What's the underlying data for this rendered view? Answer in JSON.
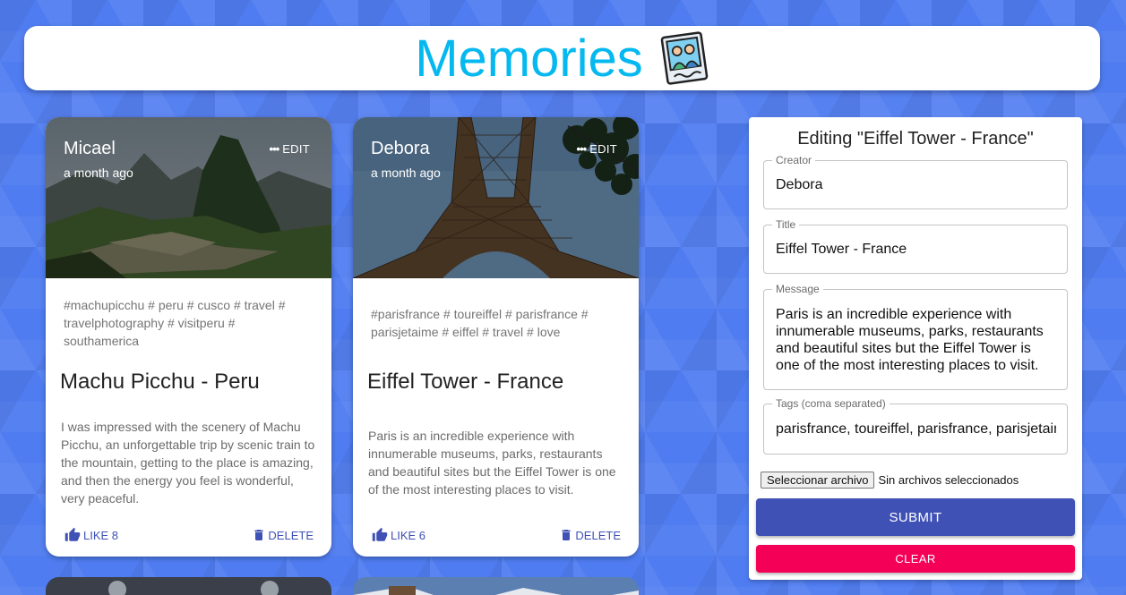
{
  "app": {
    "title": "Memories",
    "logo_icon": "memories-photo-icon",
    "accent": "#05b8ef"
  },
  "posts": [
    {
      "creator": "Micael",
      "time": "a month ago",
      "edit_label": "EDIT",
      "tags": "#machupicchu # peru # cusco # travel # travelphotography # visitperu # southamerica",
      "title": "Machu Picchu - Peru",
      "message": "I was impressed with the scenery of Machu Picchu, an unforgettable trip by scenic train to the mountain, getting to the place is amazing, and then the energy you feel is wonderful, very peaceful.",
      "like_label": "LIKE 8",
      "delete_label": "DELETE"
    },
    {
      "creator": "Debora",
      "time": "a month ago",
      "edit_label": "EDIT",
      "tags": "#parisfrance # toureiffel # parisfrance # parisjetaime # eiffel # travel # love",
      "title": "Eiffel Tower - France",
      "message": "Paris is an incredible experience with innumerable museums, parks, restaurants and beautiful sites but the Eiffel Tower is one of the most interesting places to visit.",
      "like_label": "LIKE 6",
      "delete_label": "DELETE"
    }
  ],
  "form": {
    "heading": "Editing \"Eiffel Tower - France\"",
    "creator": {
      "label": "Creator",
      "value": "Debora"
    },
    "title": {
      "label": "Title",
      "value": "Eiffel Tower - France"
    },
    "message": {
      "label": "Message",
      "value": "Paris is an incredible experience with innumerable museums, parks, restaurants and  beautiful sites but the Eiffel Tower is one of the most interesting places to visit."
    },
    "tags": {
      "label": "Tags (coma separated)",
      "value": "parisfrance, toureiffel, parisfrance, parisjetaime, eiffel, travel, love"
    },
    "file_button": "Seleccionar archivo",
    "file_status": "Sin archivos seleccionados",
    "submit_label": "SUBMIT",
    "clear_label": "CLEAR"
  },
  "colors": {
    "primary": "#3f51b5",
    "secondary": "#f50057",
    "background": "#4f7cf0"
  }
}
